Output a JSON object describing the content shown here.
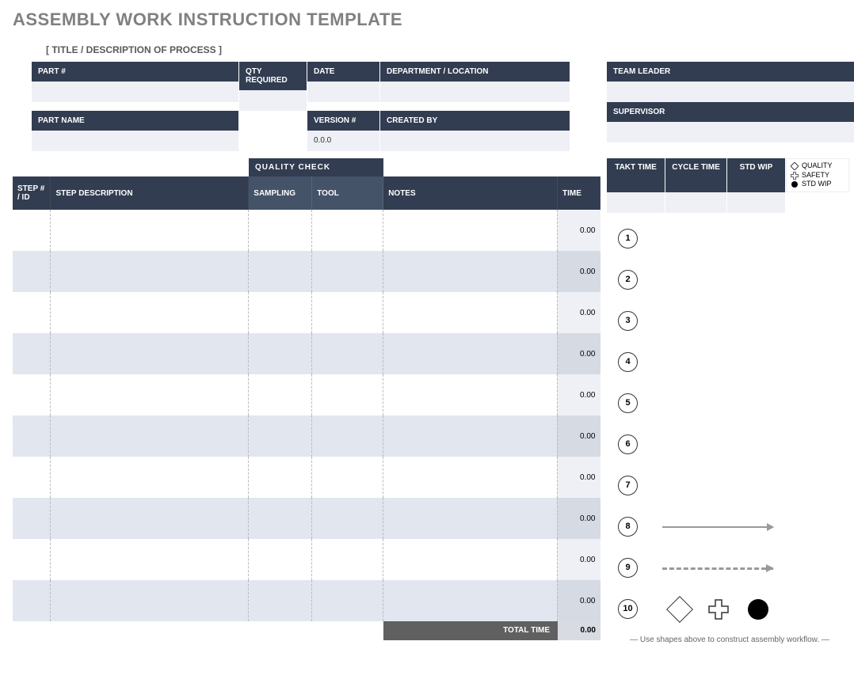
{
  "title": "ASSEMBLY WORK INSTRUCTION TEMPLATE",
  "subtitle": "[ TITLE / DESCRIPTION OF PROCESS ]",
  "info": {
    "part_num_label": "PART #",
    "part_num_value": "",
    "qty_label": "QTY REQUIRED",
    "qty_value": "",
    "date_label": "DATE",
    "date_value": "",
    "dept_label": "DEPARTMENT / LOCATION",
    "dept_value": "",
    "part_name_label": "PART NAME",
    "part_name_value": "",
    "version_label": "VERSION #",
    "version_value": "0.0.0",
    "created_label": "CREATED BY",
    "created_value": "",
    "team_leader_label": "TEAM LEADER",
    "team_leader_value": "",
    "supervisor_label": "SUPERVISOR",
    "supervisor_value": ""
  },
  "quality_check_header": "QUALITY   CHECK",
  "columns": {
    "step_id": "STEP # / ID",
    "step_desc": "STEP DESCRIPTION",
    "sampling": "SAMPLING",
    "tool": "TOOL",
    "notes": "NOTES",
    "time": "TIME"
  },
  "steps": [
    {
      "id": "",
      "desc": "",
      "sampling": "",
      "tool": "",
      "notes": "",
      "time": "0.00",
      "num": "1"
    },
    {
      "id": "",
      "desc": "",
      "sampling": "",
      "tool": "",
      "notes": "",
      "time": "0.00",
      "num": "2"
    },
    {
      "id": "",
      "desc": "",
      "sampling": "",
      "tool": "",
      "notes": "",
      "time": "0.00",
      "num": "3"
    },
    {
      "id": "",
      "desc": "",
      "sampling": "",
      "tool": "",
      "notes": "",
      "time": "0.00",
      "num": "4"
    },
    {
      "id": "",
      "desc": "",
      "sampling": "",
      "tool": "",
      "notes": "",
      "time": "0.00",
      "num": "5"
    },
    {
      "id": "",
      "desc": "",
      "sampling": "",
      "tool": "",
      "notes": "",
      "time": "0.00",
      "num": "6"
    },
    {
      "id": "",
      "desc": "",
      "sampling": "",
      "tool": "",
      "notes": "",
      "time": "0.00",
      "num": "7"
    },
    {
      "id": "",
      "desc": "",
      "sampling": "",
      "tool": "",
      "notes": "",
      "time": "0.00",
      "num": "8"
    },
    {
      "id": "",
      "desc": "",
      "sampling": "",
      "tool": "",
      "notes": "",
      "time": "0.00",
      "num": "9"
    },
    {
      "id": "",
      "desc": "",
      "sampling": "",
      "tool": "",
      "notes": "",
      "time": "0.00",
      "num": "10"
    }
  ],
  "total_label": "TOTAL TIME",
  "total_value": "0.00",
  "right": {
    "takt_label": "TAKT TIME",
    "cycle_label": "CYCLE TIME",
    "std_label": "STD WIP",
    "takt_value": "",
    "cycle_value": "",
    "std_value": ""
  },
  "legend": {
    "quality": "QUALITY",
    "safety": "SAFETY",
    "stdwip": "STD WIP"
  },
  "footer_note": "—   Use shapes above to construct assembly workflow.   —"
}
